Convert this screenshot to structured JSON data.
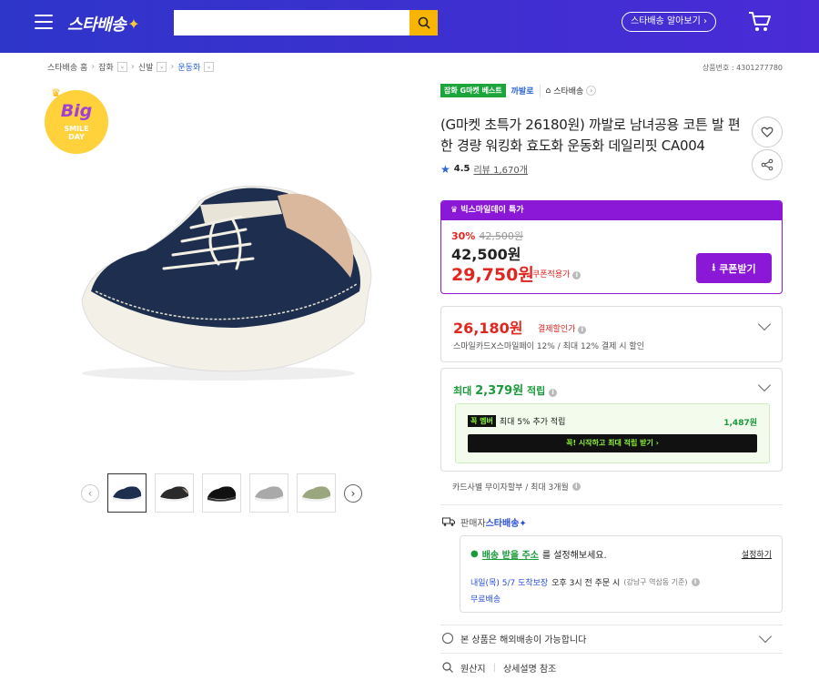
{
  "header": {
    "logo_text": "스타배송",
    "search_placeholder": "",
    "pill_label": "스타배송 알아보기 ›"
  },
  "breadcrumb": {
    "home": "스타배송 홈",
    "c1": "잡화",
    "c2": "신발",
    "c3": "운동화"
  },
  "product_no": "상품번호 : 4301277780",
  "badge": {
    "line1": "Big",
    "line2": "SMILE",
    "line3": "DAY"
  },
  "tags": {
    "green": "잡화 G마켓 베스트",
    "brand": "까발로",
    "home": "스타배송"
  },
  "title": "(G마켓 초특가 26180원) 까발로 남녀공용 코튼 발 편한 경량 워킹화 효도화 운동화 데일리핏 CA004",
  "rating": {
    "score": "4.5",
    "reviews_label": "리뷰",
    "reviews_count": "1,670개"
  },
  "promo": {
    "header": "빅스마일데이 특가",
    "discount": "30%",
    "original_strike": "42,500원",
    "price": "42,500원",
    "sale_price": "29,750원",
    "sale_label": "쿠폰적용가",
    "coupon_button": "쿠폰받기"
  },
  "payment": {
    "price": "26,180원",
    "label": "결제할인가",
    "detail": "스마일카드X스마일페이 12% / 최대 12% 결제 시 할인"
  },
  "points": {
    "prefix": "최대",
    "amount": "2,379원",
    "suffix": "적립",
    "member_badge1": "꼭",
    "member_badge2": "멤버",
    "member_text": "최대 5% 추가 적립",
    "member_value": "1,487원",
    "member_button": "꼭! 시작하고 최대 적립 받기 ›"
  },
  "card_installment": "카드사별 무이자할부 / 최대 3개월",
  "seller": {
    "label": "판매자",
    "name": "스타배송"
  },
  "shipping": {
    "address_link": "배송 받을 주소",
    "address_text": "를 설정해보세요.",
    "setting_link": "설정하기",
    "arrival": "내일(목) 5/7 도착보장",
    "cutoff": "오후 3시 전 주문 시",
    "region": "(강남구 역삼동 기준)",
    "fee": "무료배송"
  },
  "overseas": "본 상품은 해외배송이 가능합니다",
  "origin": {
    "label": "원산지",
    "value": "상세설명 참조"
  },
  "colors": {
    "header": "#3a31d0",
    "accent": "#8a18d6",
    "sale_red": "#e0261f",
    "green": "#1a9a3a",
    "search_button": "#f7b500"
  }
}
